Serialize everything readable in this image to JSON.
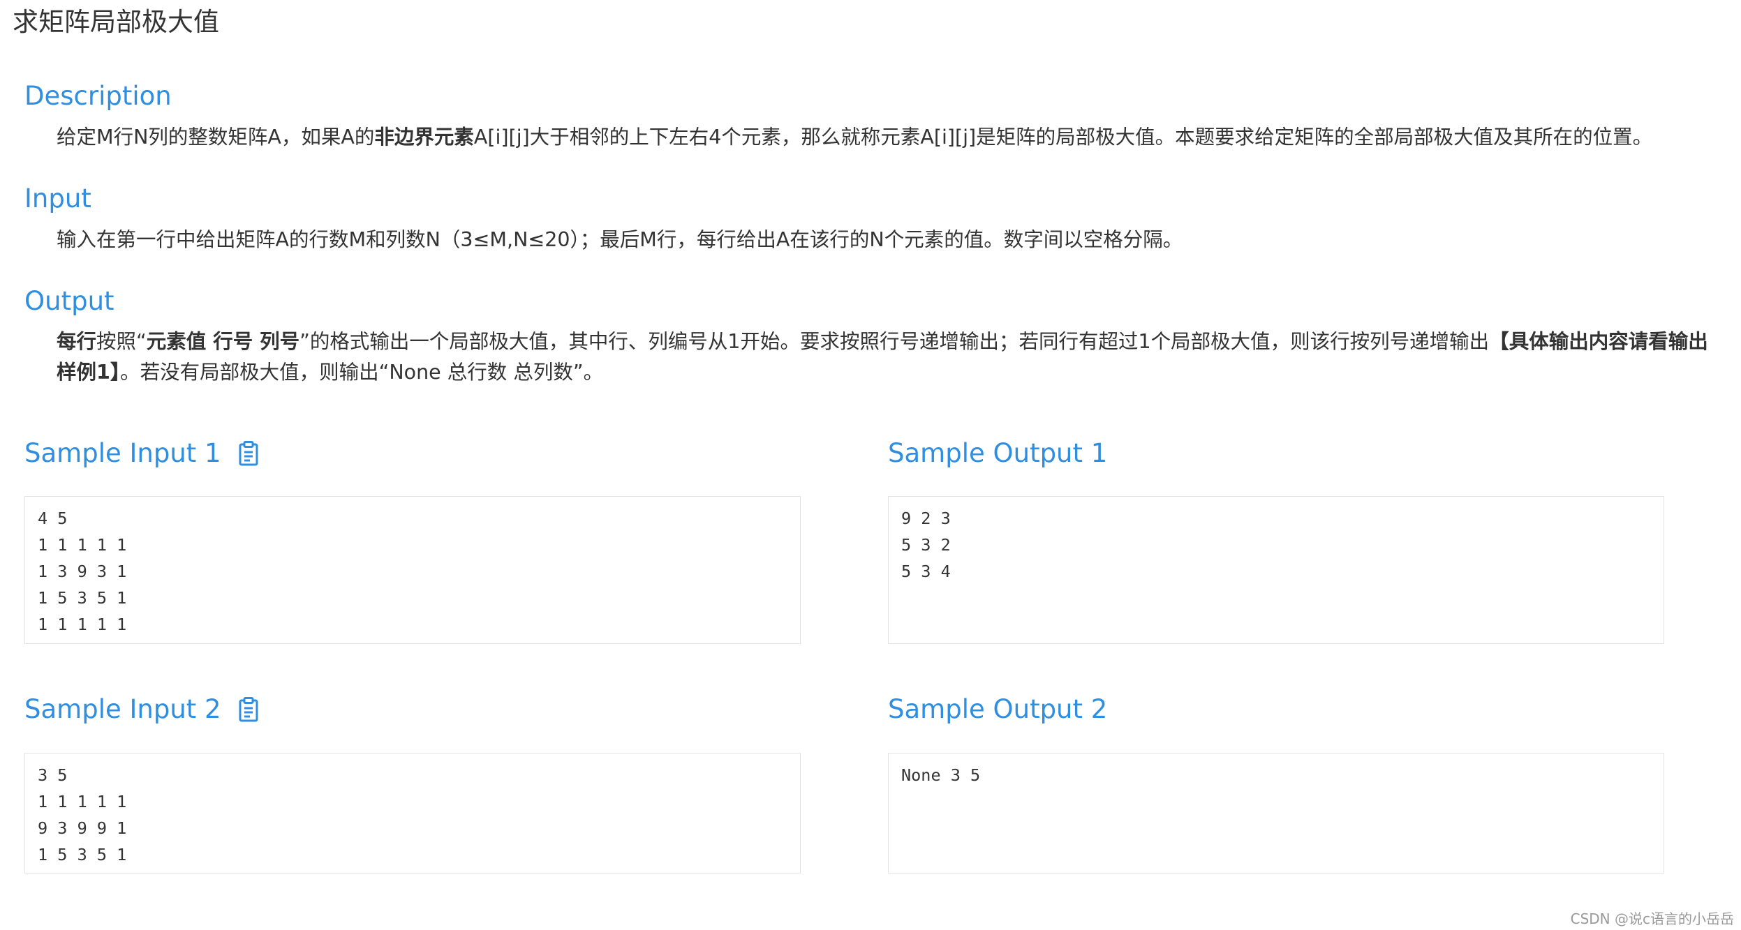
{
  "title": "求矩阵局部极大值",
  "description": {
    "heading": "Description",
    "text_1": "给定M行N列的整数矩阵A，如果A的",
    "bold_1": "非边界元素",
    "text_2": "A[i][j]大于相邻的上下左右4个元素，那么就称元素A[i][j]是矩阵的局部极大值。本题要求给定矩阵的全部局部极大值及其所在的位置。"
  },
  "input": {
    "heading": "Input",
    "text": "输入在第一行中给出矩阵A的行数M和列数N（3≤M,N≤20）；最后M行，每行给出A在该行的N个元素的值。数字间以空格分隔。"
  },
  "output": {
    "heading": "Output",
    "bold_1": "每行",
    "text_1": "按照“",
    "bold_2": "元素值 行号 列号",
    "text_2": "”的格式输出一个局部极大值，其中行、列编号从1开始。要求按照行号递增输出；若同行有超过1个局部极大值，则该行按列号递增输出",
    "bold_3": "【具体输出内容请看输出样例1】",
    "text_3": "。若没有局部极大值，则输出“None 总行数 总列数”。"
  },
  "samples": {
    "input_1": {
      "heading": "Sample Input 1",
      "content": "4 5\n1 1 1 1 1\n1 3 9 3 1\n1 5 3 5 1\n1 1 1 1 1"
    },
    "output_1": {
      "heading": "Sample Output 1",
      "content": "9 2 3\n5 3 2\n5 3 4"
    },
    "input_2": {
      "heading": "Sample Input 2",
      "content": "3 5\n1 1 1 1 1\n9 3 9 9 1\n1 5 3 5 1"
    },
    "output_2": {
      "heading": "Sample Output 2",
      "content": "None 3 5"
    }
  },
  "icons": {
    "copy": "clipboard-icon"
  },
  "colors": {
    "accent": "#2f8ee0",
    "text": "#333333",
    "border": "#e3e3e3"
  },
  "watermark": "CSDN @说c语言的小岳岳"
}
